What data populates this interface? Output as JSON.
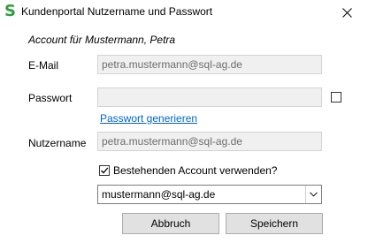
{
  "window": {
    "title": "Kundenportal Nutzername und Passwort",
    "app_icon": "S",
    "close_icon": "close-icon"
  },
  "account_heading": "Account für Mustermann, Petra",
  "fields": {
    "email": {
      "label": "E-Mail",
      "value": "petra.mustermann@sql-ag.de"
    },
    "password": {
      "label": "Passwort",
      "value": "",
      "show_checked": false
    },
    "generate_link": "Passwort generieren",
    "username": {
      "label": "Nutzername",
      "value": "petra.mustermann@sql-ag.de"
    }
  },
  "existing_account": {
    "label": "Bestehenden Account verwenden?",
    "checked": true,
    "selected": "mustermann@sql-ag.de"
  },
  "buttons": {
    "cancel": "Abbruch",
    "save": "Speichern"
  },
  "colors": {
    "accent_icon": "#2e9e3c",
    "link": "#0066cc",
    "disabled_field_bg": "#f0f0f0"
  }
}
